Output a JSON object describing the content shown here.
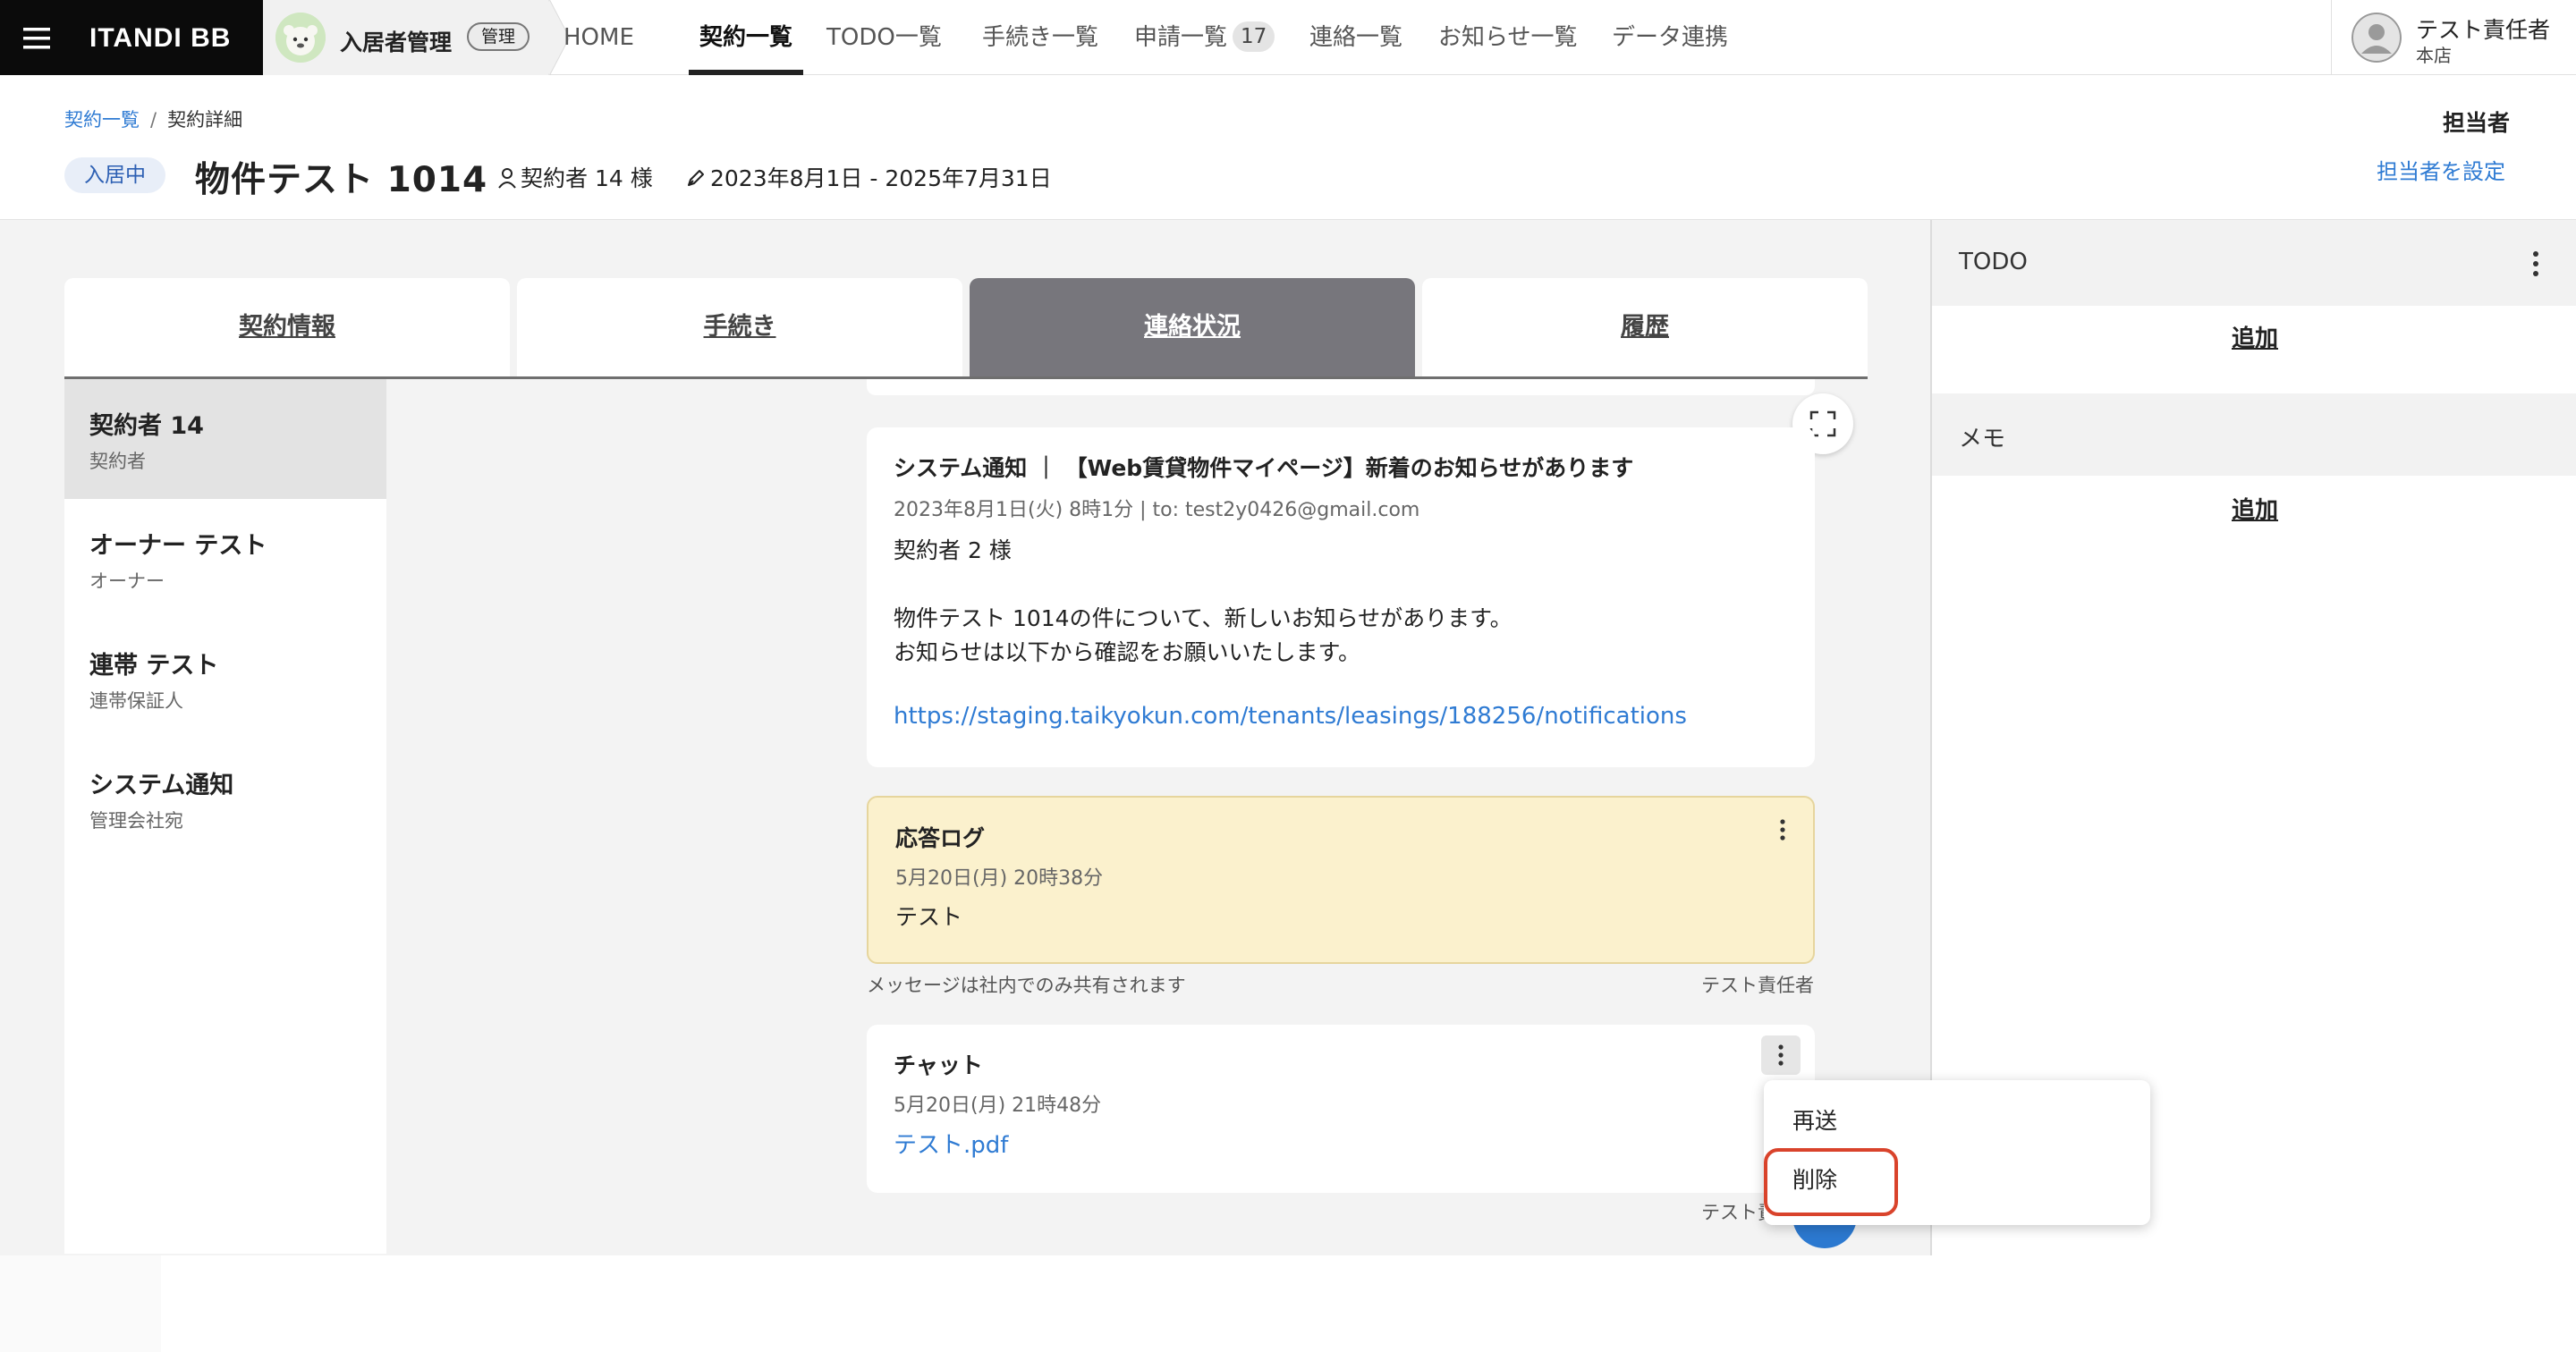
{
  "topnav": {
    "brand": "ITANDI BB",
    "app_name": "入居者管理",
    "app_badge": "管理",
    "items": [
      {
        "label": "HOME"
      },
      {
        "label": "契約一覧",
        "active": true
      },
      {
        "label": "TODO一覧"
      },
      {
        "label": "手続き一覧"
      },
      {
        "label": "申請一覧",
        "badge": "17"
      },
      {
        "label": "連絡一覧"
      },
      {
        "label": "お知らせ一覧"
      },
      {
        "label": "データ連携"
      }
    ],
    "user": {
      "name": "テスト責任者",
      "branch": "本店"
    }
  },
  "header": {
    "breadcrumb": {
      "parent": "契約一覧",
      "separator": "/",
      "current": "契約詳細"
    },
    "status": "入居中",
    "property_title": "物件テスト 1014",
    "contractor": "契約者 14 様",
    "contract_term": "2023年8月1日 - 2025年7月31日",
    "assignee_title": "担当者",
    "assignee_link": "担当者を設定"
  },
  "tabs": [
    {
      "label": "契約情報"
    },
    {
      "label": "手続き"
    },
    {
      "label": "連絡状況",
      "active": true
    },
    {
      "label": "履歴"
    }
  ],
  "parties": [
    {
      "name": "契約者 14",
      "role": "契約者",
      "active": true
    },
    {
      "name": "オーナー テスト",
      "role": "オーナー"
    },
    {
      "name": "連帯 テスト",
      "role": "連帯保証人"
    },
    {
      "name": "システム通知",
      "role": "管理会社宛"
    }
  ],
  "messages": {
    "notification": {
      "title": "システム通知 ｜ 【Web賃貸物件マイページ】新着のお知らせがあります",
      "meta": "2023年8月1日(火) 8時1分  |  to: test2y0426@gmail.com",
      "line1": "契約者 2 様",
      "line2": "物件テスト 1014の件について、新しいお知らせがあります。",
      "line3": "お知らせは以下から確認をお願いいたします。",
      "link": "https://staging.taikyokun.com/tenants/leasings/188256/notifications"
    },
    "response_log": {
      "title": "応答ログ",
      "meta": "5月20日(月) 20時38分",
      "body": "テスト",
      "note": "メッセージは社内でのみ共有されます",
      "author": "テスト責任者"
    },
    "chat": {
      "title": "チャット",
      "meta": "5月20日(月) 21時48分",
      "attachment": "テスト.pdf",
      "author_partial": "テスト責"
    }
  },
  "right_panel": {
    "todo": {
      "title": "TODO",
      "add": "追加"
    },
    "memo": {
      "title": "メモ",
      "add": "追加"
    }
  },
  "context_menu": {
    "items": [
      {
        "label": "再送"
      },
      {
        "label": "削除",
        "highlighted": true
      }
    ]
  },
  "colors": {
    "brand_bg": "#0b0b0b",
    "accent_link": "#2f7bd3",
    "active_tab": "#77767c",
    "log_bg": "#fbf1cd",
    "highlight": "#d9432b"
  },
  "icons": {
    "hamburger": "menu-icon",
    "app_avatar": "mascot-icon",
    "user_avatar": "person-icon",
    "contractor": "person-icon",
    "contract_term": "pen-icon",
    "expand": "fullscreen-icon",
    "kebab": "more-vertical-icon"
  }
}
